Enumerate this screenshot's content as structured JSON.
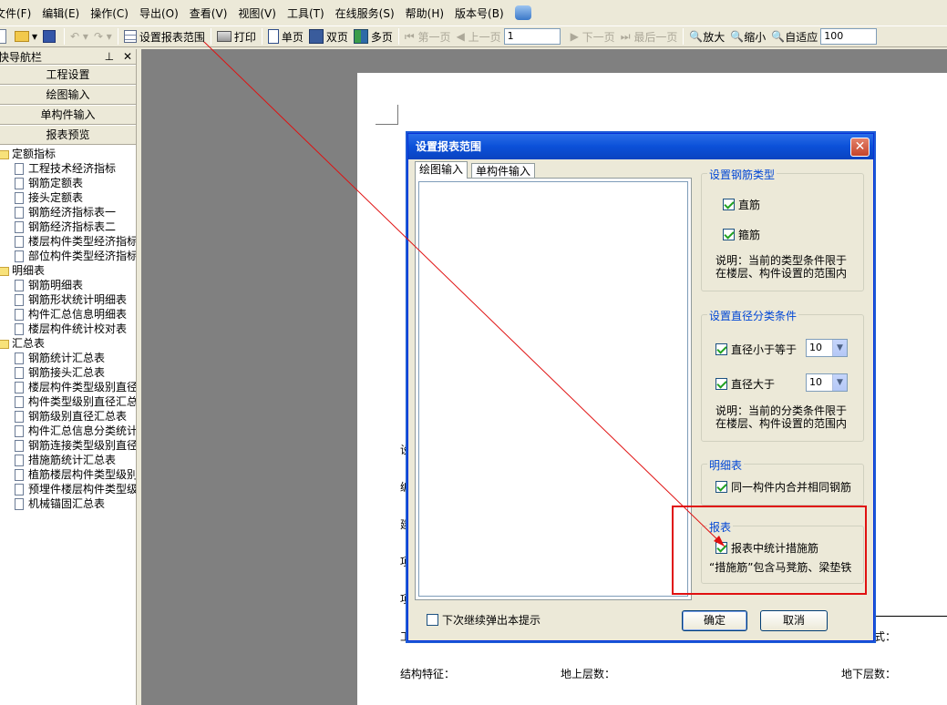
{
  "menu": [
    "文件(F)",
    "编辑(E)",
    "操作(C)",
    "导出(O)",
    "查看(V)",
    "视图(V)",
    "工具(T)",
    "在线服务(S)",
    "帮助(H)",
    "版本号(B)"
  ],
  "toolbar": {
    "set_range": "设置报表范围",
    "print": "打印",
    "single_page": "单页",
    "double_page": "双页",
    "multi_page": "多页",
    "first_page": "第一页",
    "prev_page": "上一页",
    "page_value": "1",
    "next_page": "下一页",
    "last_page": "最后一页",
    "zoom_in": "放大",
    "zoom_out": "缩小",
    "fit": "自适应",
    "zoom_value": "100"
  },
  "nav": {
    "title": "快导航栏",
    "buttons": [
      "工程设置",
      "绘图输入",
      "单构件输入",
      "报表预览"
    ],
    "tree": [
      {
        "label": "定额指标",
        "items": [
          "工程技术经济指标",
          "钢筋定额表",
          "接头定额表",
          "钢筋经济指标表一",
          "钢筋经济指标表二",
          "楼层构件类型经济指标",
          "部位构件类型经济指标"
        ]
      },
      {
        "label": "明细表",
        "items": [
          "钢筋明细表",
          "钢筋形状统计明细表",
          "构件汇总信息明细表",
          "楼层构件统计校对表"
        ]
      },
      {
        "label": "汇总表",
        "items": [
          "钢筋统计汇总表",
          "钢筋接头汇总表",
          "楼层构件类型级别直径",
          "构件类型级别直径汇总",
          "钢筋级别直径汇总表",
          "构件汇总信息分类统计",
          "钢筋连接类型级别直径",
          "措施筋统计汇总表",
          "植筋楼层构件类型级别",
          "预埋件楼层构件类型级",
          "机械锚固汇总表"
        ]
      }
    ]
  },
  "paper": {
    "left_labels": [
      "设",
      "编",
      "建",
      "项",
      "项",
      "工"
    ],
    "right_label": "式：",
    "structure": "结构特征：",
    "above_floors": "地上层数：",
    "below_floors": "地下层数："
  },
  "dialog": {
    "title": "设置报表范围",
    "tabs": [
      "绘图输入",
      "单构件输入"
    ],
    "rebar_type": {
      "title": "设置钢筋类型",
      "straight": "直筋",
      "stirrup": "箍筋",
      "note_line1": "说明：当前的类型条件限于",
      "note_line2": "在楼层、构件设置的范围内"
    },
    "diameter": {
      "title": "设置直径分类条件",
      "le_label": "直径小于等于",
      "le_value": "10",
      "gt_label": "直径大于",
      "gt_value": "10",
      "note_line1": "说明：当前的分类条件限于",
      "note_line2": "在楼层、构件设置的范围内"
    },
    "detail": {
      "title": "明细表",
      "merge": "同一构件内合并相同钢筋"
    },
    "report": {
      "title": "报表",
      "count_measure": "报表中统计措施筋",
      "note": "“措施筋”包含马凳筋、梁垫铁"
    },
    "show_next": "下次继续弹出本提示",
    "ok": "确定",
    "cancel": "取消"
  }
}
